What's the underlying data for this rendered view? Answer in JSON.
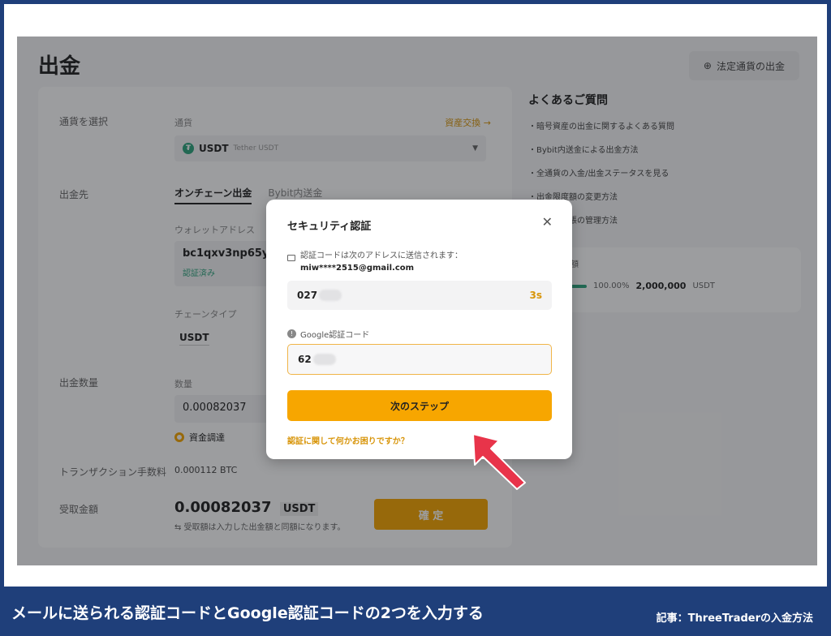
{
  "page": {
    "title": "出金",
    "fiat_button": "法定通貨の出金"
  },
  "form": {
    "asset_label": "通貨を選択",
    "coin_label": "通貨",
    "deposit_link": "資産交換 →",
    "coin_symbol": "USDT",
    "coin_name": "Tether USDT",
    "destination_label": "出金先",
    "tabs": [
      "オンチェーン出金",
      "Bybit内送金"
    ],
    "wallet_address_label": "ウォレットアドレス",
    "address": "bc1qxv3np65yes8",
    "address_status": "認証済み",
    "network_label": "チェーンタイプ",
    "network": "USDT",
    "amount_section_label": "出金数量",
    "amount_label": "数量",
    "amount_value": "0.00082037",
    "fund_source": "資金調達",
    "fee_label": "トランザクション手数料",
    "fee_value": "0.000112 BTC",
    "receive_label": "受取金額",
    "receive_amount": "0.00082037",
    "receive_unit": "USDT",
    "receive_note": "⇆ 受取額は入力した出金額と同額になります。",
    "confirm_button": "確 定"
  },
  "faq": {
    "title": "よくあるご質問",
    "items": [
      "・暗号資産の出金に関するよくある質問",
      "・Bybit内送金による出金方法",
      "・全通貨の入金/出金ステータスを見る",
      "・出金限度額の変更方法",
      "・アドレス帳の管理方法"
    ],
    "limit_label": "出金限度額",
    "limit_used": "100.00%",
    "limit_amount": "2,000,000",
    "limit_currency": "USDT"
  },
  "modal": {
    "title": "セキュリティ認証",
    "email_info_prefix": "認証コードは次のアドレスに送信されます：",
    "email_address": "miw****2515@gmail.com",
    "email_code_value": "027",
    "timer": "3s",
    "google_label": "Google認証コード",
    "google_code_value": "62",
    "next_button": "次のステップ",
    "help_link": "認証に関して何かお困りですか？"
  },
  "caption": {
    "main": "メールに送られる認証コードとGoogle認証コードの2つを入力する",
    "sub": "記事：ThreeTraderの入金方法"
  },
  "colors": {
    "accent": "#f7a600",
    "frame": "#1f3f7a",
    "arrow": "#e8344a"
  }
}
